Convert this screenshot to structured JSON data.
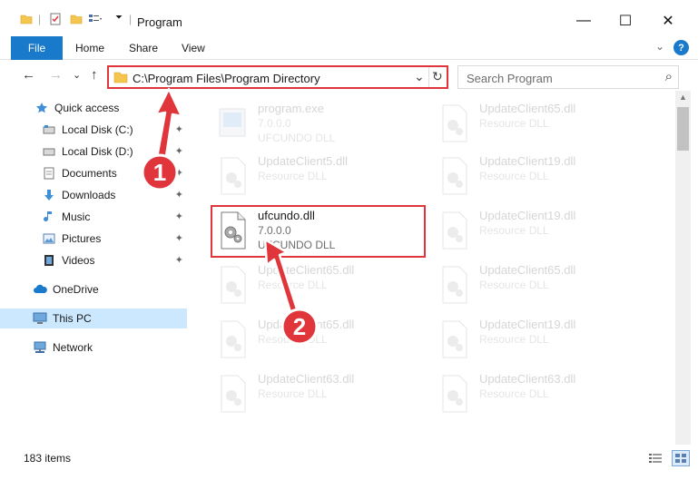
{
  "window": {
    "title": "Program",
    "minimize_glyph": "—",
    "maximize_glyph": "☐",
    "close_glyph": "✕"
  },
  "ribbon": {
    "tabs": [
      "File",
      "Home",
      "Share",
      "View"
    ],
    "expand_glyph": "⌄",
    "help_glyph": "?"
  },
  "nav": {
    "back_glyph": "←",
    "forward_glyph": "→",
    "recent_glyph": "⌄",
    "up_glyph": "↑",
    "address": "C:\\Program Files\\Program Directory",
    "address_dropdown_glyph": "⌄",
    "refresh_glyph": "↻",
    "search_placeholder": "Search Program",
    "search_glyph": "⌕"
  },
  "sidebar": {
    "items": [
      {
        "label": "Quick access",
        "icon": "star-icon"
      },
      {
        "label": "Local Disk (C:)",
        "icon": "drive-icon",
        "pinned": true
      },
      {
        "label": "Local Disk (D:)",
        "icon": "drive-icon",
        "pinned": true
      },
      {
        "label": "Documents",
        "icon": "documents-icon",
        "pinned": true
      },
      {
        "label": "Downloads",
        "icon": "downloads-icon",
        "pinned": true
      },
      {
        "label": "Music",
        "icon": "music-icon",
        "pinned": true
      },
      {
        "label": "Pictures",
        "icon": "pictures-icon",
        "pinned": true
      },
      {
        "label": "Videos",
        "icon": "videos-icon",
        "pinned": true
      },
      {
        "label": "OneDrive",
        "icon": "cloud-icon"
      },
      {
        "label": "This PC",
        "icon": "computer-icon",
        "selected": true
      },
      {
        "label": "Network",
        "icon": "network-icon"
      }
    ],
    "pin_glyph": "📌"
  },
  "files": [
    {
      "name": "program.exe",
      "line2": "7.0.0.0",
      "line3": "UFCUNDO DLL",
      "type": "exe",
      "faded": true
    },
    {
      "name": "UpdateClient65.dll",
      "line2": "Resource DLL",
      "line3": "",
      "type": "dll",
      "faded": true
    },
    {
      "name": "UpdateClient5.dll",
      "line2": "Resource DLL",
      "line3": "",
      "type": "dll",
      "faded": true
    },
    {
      "name": "UpdateClient19.dll",
      "line2": "Resource DLL",
      "line3": "",
      "type": "dll",
      "faded": true
    },
    {
      "name": "ufcundo.dll",
      "line2": "7.0.0.0",
      "line3": "UFCUNDO DLL",
      "type": "dll",
      "faded": false
    },
    {
      "name": "UpdateClient19.dll",
      "line2": "Resource DLL",
      "line3": "",
      "type": "dll",
      "faded": true
    },
    {
      "name": "UpdateClient65.dll",
      "line2": "Resource DLL",
      "line3": "",
      "type": "dll",
      "faded": true
    },
    {
      "name": "UpdateClient65.dll",
      "line2": "Resource DLL",
      "line3": "",
      "type": "dll",
      "faded": true
    },
    {
      "name": "UpdateClient65.dll",
      "line2": "Resource DLL",
      "line3": "",
      "type": "dll",
      "faded": true
    },
    {
      "name": "UpdateClient19.dll",
      "line2": "Resource DLL",
      "line3": "",
      "type": "dll",
      "faded": true
    },
    {
      "name": "UpdateClient63.dll",
      "line2": "Resource DLL",
      "line3": "",
      "type": "dll",
      "faded": true
    },
    {
      "name": "UpdateClient63.dll",
      "line2": "Resource DLL",
      "line3": "",
      "type": "dll",
      "faded": true
    }
  ],
  "annotations": {
    "step1": "1",
    "step2": "2",
    "accent_color": "#e0363b"
  },
  "status": {
    "item_count": "183 items"
  },
  "colors": {
    "file_tab": "#1979ca",
    "selected_nav": "#cce8ff"
  }
}
